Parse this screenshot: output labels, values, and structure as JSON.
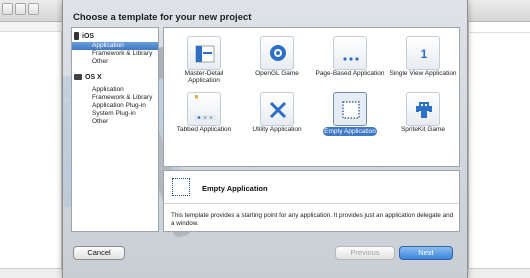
{
  "sheet": {
    "title": "Choose a template for your new project"
  },
  "categories": {
    "ios": {
      "header": "iOS",
      "items": [
        "Application",
        "Framework & Library",
        "Other"
      ]
    },
    "osx": {
      "header": "OS X",
      "items": [
        "Application",
        "Framework & Library",
        "Application Plug-in",
        "System Plug-in",
        "Other"
      ]
    }
  },
  "templates": [
    {
      "label": "Master-Detail Application",
      "icon": "master-detail-icon"
    },
    {
      "label": "OpenGL Game",
      "icon": "opengl-icon"
    },
    {
      "label": "Page-Based Application",
      "icon": "page-based-icon"
    },
    {
      "label": "Single View Application",
      "icon": "single-view-icon"
    },
    {
      "label": "Tabbed Application",
      "icon": "tabbed-icon"
    },
    {
      "label": "Utility Application",
      "icon": "utility-icon"
    },
    {
      "label": "Empty Application",
      "icon": "empty-app-icon",
      "selected": true
    },
    {
      "label": "SpriteKit Game",
      "icon": "spritekit-icon"
    }
  ],
  "description": {
    "title": "Empty Application",
    "text": "This template provides a starting point for any application. It provides just an application delegate and a window."
  },
  "buttons": {
    "cancel": "Cancel",
    "previous": "Previous",
    "next": "Next"
  },
  "colors": {
    "accent": "#3f78c4",
    "next_button": "#3b86dc"
  }
}
